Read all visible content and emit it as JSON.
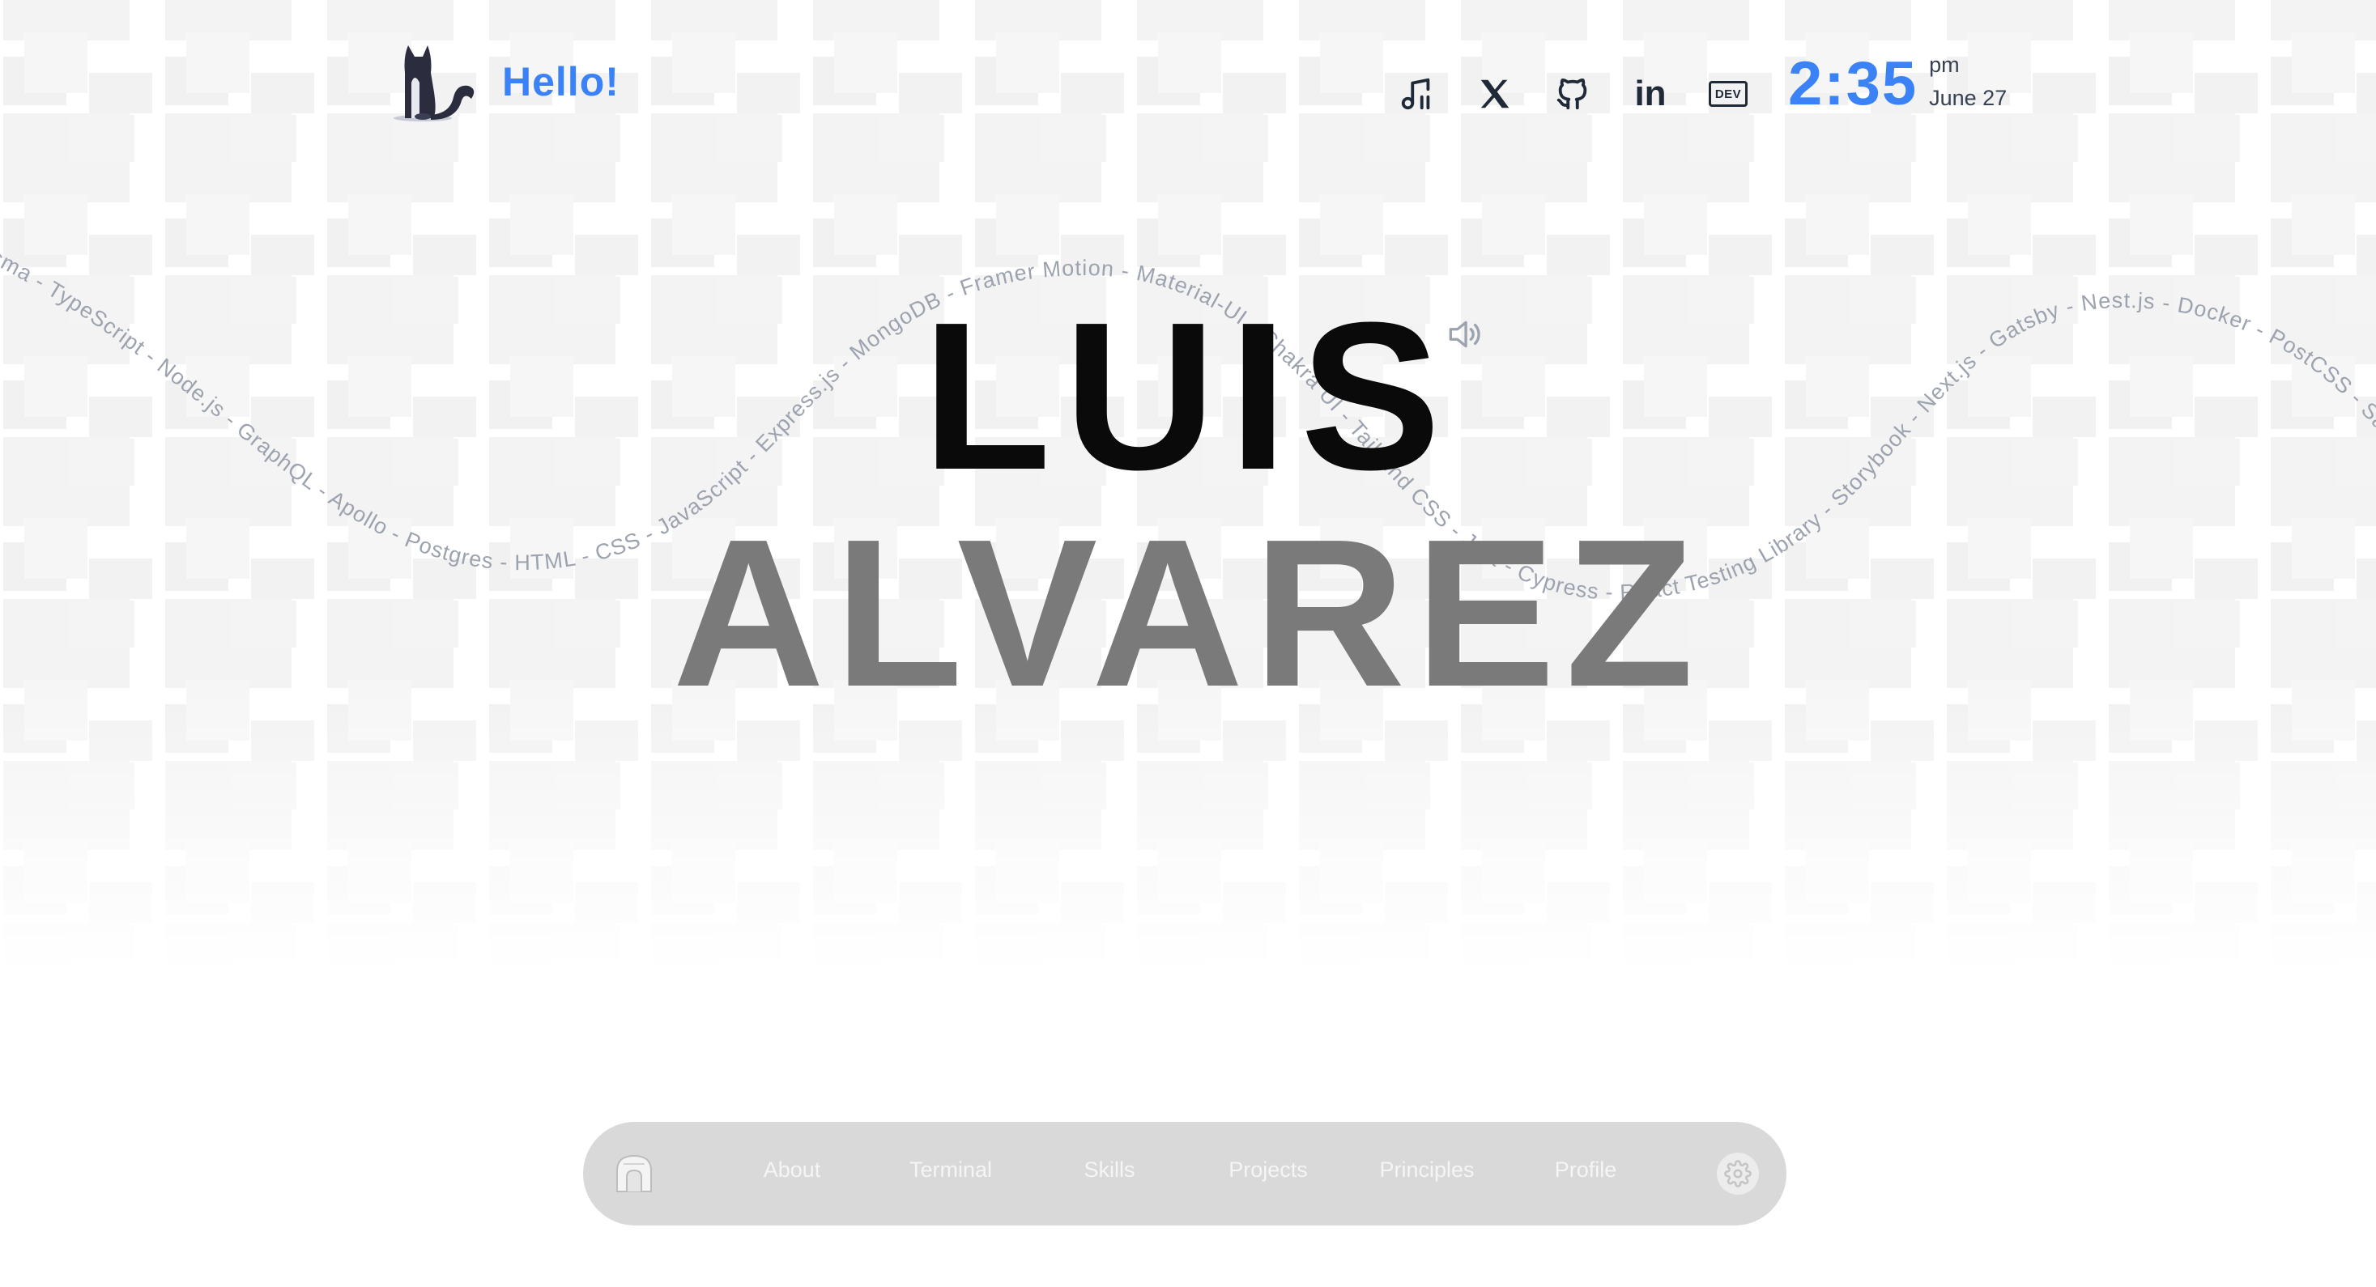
{
  "header": {
    "greeting": "Hello!",
    "social": [
      {
        "name": "music",
        "icon": "music-note-icon"
      },
      {
        "name": "x",
        "icon": "x-logo-icon"
      },
      {
        "name": "github",
        "icon": "github-icon"
      },
      {
        "name": "linkedin",
        "icon": "linkedin-icon",
        "label": "in"
      },
      {
        "name": "dev",
        "icon": "dev-to-icon",
        "label": "DEV"
      }
    ],
    "clock": {
      "time": "2:35",
      "ampm": "pm",
      "date": "June 27"
    }
  },
  "hero": {
    "first_name": "LUIS",
    "last_name": "ALVAREZ",
    "skills_text": "isma - TypeScript - Node.js - GraphQL - Apollo - Postgres - HTML - CSS - JavaScript - Express.js - MongoDB - Framer Motion - Material-UI - Chakra UI - Tailwind CSS - Jest - Cypress - React Testing Library - Storybook - Next.js - Gatsby - Nest.js - Docker - PostCSS - Sass - Vercel"
  },
  "dock": {
    "items": [
      {
        "label": "About"
      },
      {
        "label": "Terminal"
      },
      {
        "label": "Skills"
      },
      {
        "label": "Projects"
      },
      {
        "label": "Principles"
      },
      {
        "label": "Profile"
      }
    ]
  },
  "colors": {
    "accent": "#3b82f6",
    "name_primary": "#0a0a0a",
    "name_secondary": "#7a7a7a",
    "dock": "#d9d9d9"
  }
}
